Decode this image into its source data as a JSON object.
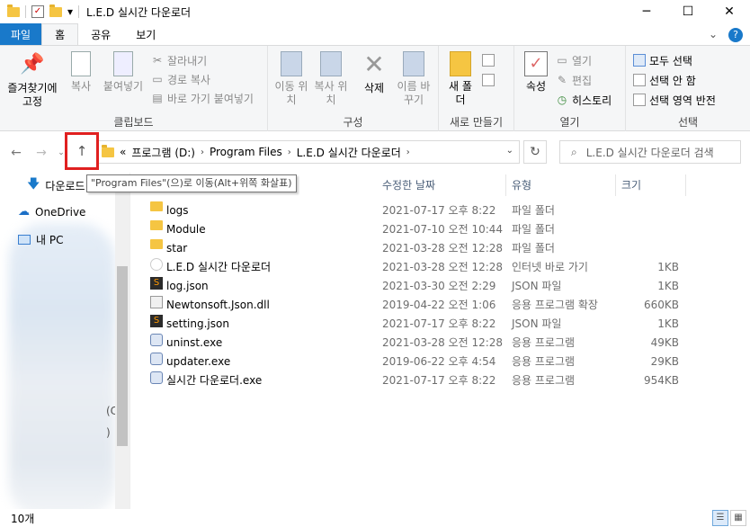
{
  "title_bar": {
    "title": "L.E.D 실시간 다운로더",
    "qa_dropdown": "▾"
  },
  "ribbon_tabs": {
    "file": "파일",
    "home": "홈",
    "share": "공유",
    "view": "보기"
  },
  "ribbon": {
    "clipboard": {
      "pin": "즐겨찾기에 고정",
      "copy": "복사",
      "paste": "붙여넣기",
      "cut": "잘라내기",
      "copy_path": "경로 복사",
      "paste_shortcut": "바로 가기 붙여넣기",
      "label": "클립보드"
    },
    "organize": {
      "move_to": "이동 위치",
      "copy_to": "복사 위치",
      "delete": "삭제",
      "rename": "이름 바꾸기",
      "label": "구성"
    },
    "new": {
      "new_folder": "새 폴더",
      "label": "새로 만들기"
    },
    "open": {
      "properties": "속성",
      "open": "열기",
      "edit": "편집",
      "history": "히스토리",
      "label": "열기"
    },
    "select": {
      "select_all": "모두 선택",
      "select_none": "선택 안 함",
      "invert": "선택 영역 반전",
      "label": "선택"
    }
  },
  "address": {
    "crumbs": [
      "프로그램 (D:)",
      "Program Files",
      "L.E.D 실시간 다운로더"
    ],
    "overflow": "«",
    "search_placeholder": "L.E.D 실시간 다운로더 검색"
  },
  "tooltip": "\"Program Files\"(으)로 이동(Alt+위쪽 화살표)",
  "nav_pane": {
    "downloads": "다운로드",
    "onedrive": "OneDrive",
    "this_pc": "내 PC",
    "partial_1": "(C",
    "partial_2": ")"
  },
  "columns": {
    "date": "수정한 날짜",
    "type": "유형",
    "size": "크기"
  },
  "files": [
    {
      "name": "logs",
      "date": "2021-07-17 오후 8:22",
      "type": "파일 폴더",
      "size": "",
      "icon": "folder"
    },
    {
      "name": "Module",
      "date": "2021-07-10 오전 10:44",
      "type": "파일 폴더",
      "size": "",
      "icon": "folder"
    },
    {
      "name": "star",
      "date": "2021-03-28 오전 12:28",
      "type": "파일 폴더",
      "size": "",
      "icon": "folder"
    },
    {
      "name": "L.E.D 실시간 다운로더",
      "date": "2021-03-28 오전 12:28",
      "type": "인터넷 바로 가기",
      "size": "1KB",
      "icon": "web"
    },
    {
      "name": "log.json",
      "date": "2021-03-30 오전 2:29",
      "type": "JSON 파일",
      "size": "1KB",
      "icon": "json"
    },
    {
      "name": "Newtonsoft.Json.dll",
      "date": "2019-04-22 오전 1:06",
      "type": "응용 프로그램 확장",
      "size": "660KB",
      "icon": "dll"
    },
    {
      "name": "setting.json",
      "date": "2021-07-17 오후 8:22",
      "type": "JSON 파일",
      "size": "1KB",
      "icon": "json"
    },
    {
      "name": "uninst.exe",
      "date": "2021-03-28 오전 12:28",
      "type": "응용 프로그램",
      "size": "49KB",
      "icon": "exe"
    },
    {
      "name": "updater.exe",
      "date": "2019-06-22 오후 4:54",
      "type": "응용 프로그램",
      "size": "29KB",
      "icon": "exe"
    },
    {
      "name": "실시간 다운로더.exe",
      "date": "2021-07-17 오후 8:22",
      "type": "응용 프로그램",
      "size": "954KB",
      "icon": "exe"
    }
  ],
  "status": {
    "count": "10개"
  },
  "colors": {
    "file_tab": "#1979ca",
    "highlight_box": "#e02020"
  }
}
